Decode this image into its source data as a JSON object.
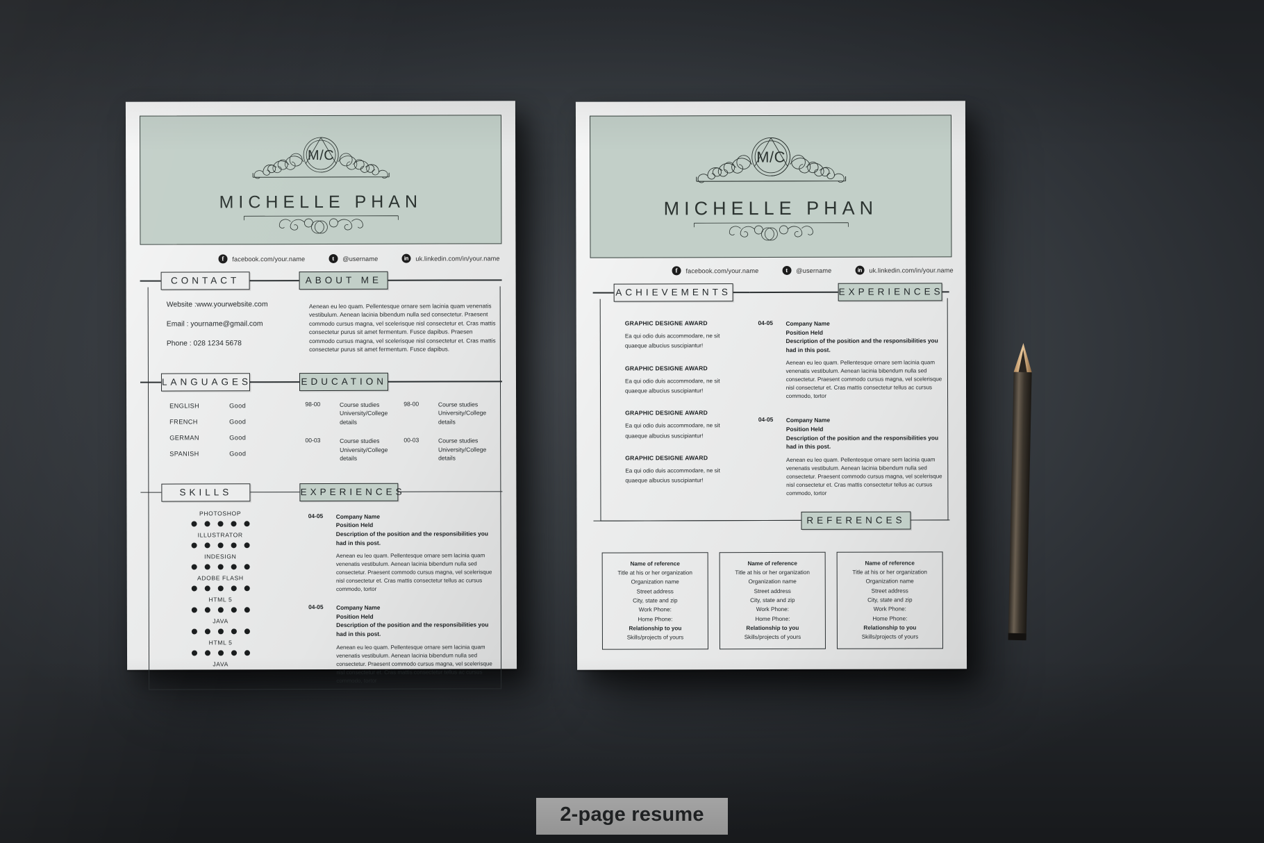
{
  "caption": "2-page resume",
  "colors": {
    "accent": "#c2cfc8",
    "paper": "#eceded",
    "ink": "#23282a",
    "backdrop": "#3d4247"
  },
  "identity": {
    "monogram": "M/C",
    "name": "MICHELLE PHAN"
  },
  "social": [
    {
      "icon": "facebook-icon",
      "glyph": "f",
      "label": "facebook.com/your.name"
    },
    {
      "icon": "twitter-icon",
      "glyph": "t",
      "label": "@username"
    },
    {
      "icon": "linkedin-icon",
      "glyph": "in",
      "label": "uk.linkedin.com/in/your.name"
    }
  ],
  "page1": {
    "sections": {
      "contact": "CONTACT",
      "about": "ABOUT ME",
      "languages": "LANGUAGES",
      "education": "EDUCATION",
      "skills": "SKILLS",
      "experiences": "EXPERIENCES"
    },
    "contact": [
      "Website :www.yourwebsite.com",
      "Email : yourname@gmail.com",
      "Phone : 028 1234 5678"
    ],
    "about_text": "Aenean eu leo quam. Pellentesque ornare sem lacinia quam venenatis vestibulum. Aenean lacinia bibendum nulla sed consectetur. Praesent commodo cursus magna, vel scelerisque nisl consectetur et. Cras mattis consectetur purus sit amet fermentum. Fusce dapibus. Praesen  commodo cursus magna, vel scelerisque nisl consectetur et. Cras mattis consectetur purus sit amet fermentum. Fusce dapibus.",
    "languages": [
      {
        "name": "ENGLISH",
        "level": "Good"
      },
      {
        "name": "FRENCH",
        "level": "Good"
      },
      {
        "name": "GERMAN",
        "level": "Good"
      },
      {
        "name": "SPANISH",
        "level": "Good"
      }
    ],
    "education": [
      {
        "years": "98-00",
        "line1": "Course studies",
        "line2": "University/College details"
      },
      {
        "years": "00-03",
        "line1": "Course studies",
        "line2": "University/College details"
      },
      {
        "years": "98-00",
        "line1": "Course studies",
        "line2": "University/College details"
      },
      {
        "years": "00-03",
        "line1": "Course studies",
        "line2": "University/College details"
      }
    ],
    "skills": [
      {
        "name": "PHOTOSHOP",
        "dots": 5
      },
      {
        "name": "ILLUSTRATOR",
        "dots": 5
      },
      {
        "name": "INDESIGN",
        "dots": 5
      },
      {
        "name": "ADOBE FLASH",
        "dots": 5
      },
      {
        "name": "HTML 5",
        "dots": 5
      },
      {
        "name": "JAVA",
        "dots": 5
      },
      {
        "name": "HTML 5",
        "dots": 5
      },
      {
        "name": "JAVA",
        "dots": 5
      }
    ],
    "experiences": [
      {
        "years": "04-05",
        "company": "Company Name",
        "position": "Position Held",
        "description": "Description of the position and the responsibilities you had in this post.",
        "body": "Aenean eu leo quam. Pellentesque ornare sem lacinia quam venenatis vestibulum. Aenean lacinia bibendum nulla sed consectetur. Praesent commodo cursus magna, vel scelerisque nisl consectetur et. Cras mattis consectetur tellus ac cursus commodo, tortor"
      },
      {
        "years": "04-05",
        "company": "Company Name",
        "position": "Position Held",
        "description": "Description of the position and the responsibilities you had in this post.",
        "body": "Aenean eu leo quam. Pellentesque ornare sem lacinia quam venenatis vestibulum. Aenean lacinia bibendum nulla sed consectetur. Praesent commodo cursus magna, vel scelerisque nisl consectetur et. Cras mattis consectetur tellus ac cursus commodo, tortor"
      }
    ]
  },
  "page2": {
    "sections": {
      "achievements": "ACHIEVEMENTS",
      "experiences": "EXPERIENCES",
      "references": "REFERENCES"
    },
    "achievements": [
      {
        "title": "GRAPHIC DESIGNE  AWARD",
        "line1": "Ea qui odio duis accommodare, ne sit",
        "line2": "quaeque albucius suscipiantur!"
      },
      {
        "title": "GRAPHIC DESIGNE  AWARD",
        "line1": "Ea qui odio duis accommodare, ne sit",
        "line2": "quaeque albucius suscipiantur!"
      },
      {
        "title": "GRAPHIC DESIGNE  AWARD",
        "line1": "Ea qui odio duis accommodare, ne sit",
        "line2": "quaeque albucius suscipiantur!"
      },
      {
        "title": "GRAPHIC DESIGNE  AWARD",
        "line1": "Ea qui odio duis accommodare, ne sit",
        "line2": "quaeque albucius suscipiantur!"
      }
    ],
    "experiences": [
      {
        "years": "04-05",
        "company": "Company Name",
        "position": "Position Held",
        "description": "Description of the position and the responsibilities you had in this post.",
        "body": "Aenean eu leo quam. Pellentesque ornare sem lacinia quam venenatis vestibulum. Aenean lacinia bibendum nulla sed consectetur. Praesent commodo cursus magna, vel scelerisque nisl consectetur et. Cras mattis consectetur tellus ac cursus commodo, tortor"
      },
      {
        "years": "04-05",
        "company": "Company Name",
        "position": "Position Held",
        "description": "Description of the position and the responsibilities you had in this post.",
        "body": "Aenean eu leo quam. Pellentesque ornare sem lacinia quam venenatis vestibulum. Aenean lacinia bibendum nulla sed consectetur. Praesent commodo cursus magna, vel scelerisque nisl consectetur et. Cras mattis consectetur tellus ac cursus commodo, tortor"
      }
    ],
    "references": [
      {
        "l1": "Name of reference",
        "l2": "Title at his or her organization",
        "l3": "Organization name",
        "l4": "Street address",
        "l5": "City, state and zip",
        "l6": "Work Phone:",
        "l7": "Home Phone:",
        "l8": "Relationship to you",
        "l9": "Skills/projects of yours"
      },
      {
        "l1": "Name of reference",
        "l2": "Title at his or her organization",
        "l3": "Organization name",
        "l4": "Street address",
        "l5": "City, state and zip",
        "l6": "Work Phone:",
        "l7": "Home Phone:",
        "l8": "Relationship to you",
        "l9": "Skills/projects of yours"
      },
      {
        "l1": "Name of reference",
        "l2": "Title at his or her organization",
        "l3": "Organization name",
        "l4": "Street address",
        "l5": "City, state and zip",
        "l6": "Work Phone:",
        "l7": "Home Phone:",
        "l8": "Relationship to you",
        "l9": "Skills/projects of yours"
      }
    ]
  },
  "props": {
    "pencil": "pencil"
  }
}
